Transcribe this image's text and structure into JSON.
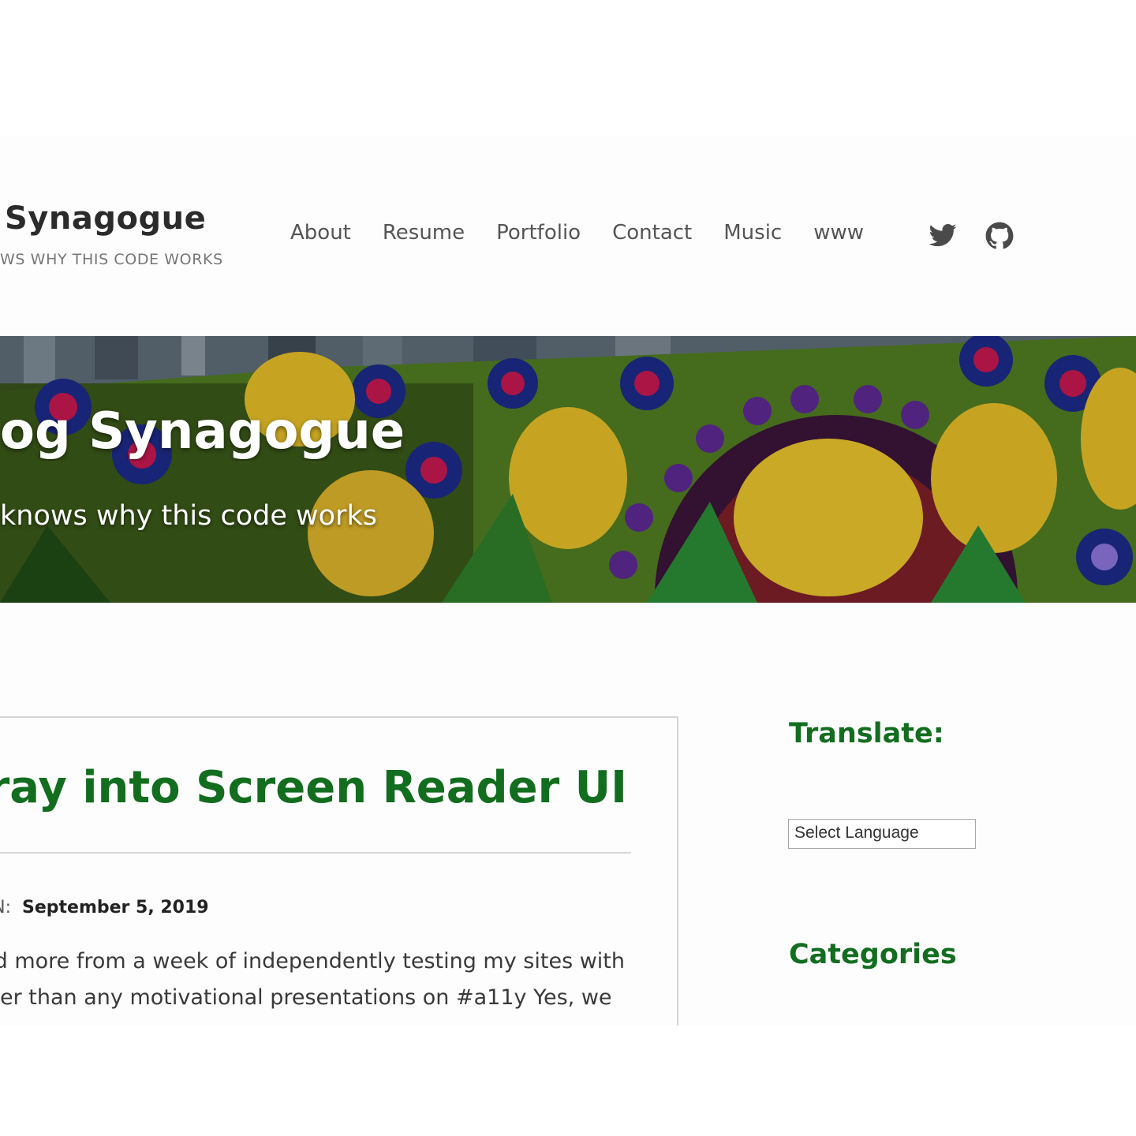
{
  "site": {
    "title": "Synagogue",
    "tagline": "WS WHY THIS CODE WORKS"
  },
  "nav": {
    "items": [
      {
        "label": "About"
      },
      {
        "label": "Resume"
      },
      {
        "label": "Portfolio"
      },
      {
        "label": "Contact"
      },
      {
        "label": "Music"
      },
      {
        "label": "www"
      }
    ]
  },
  "social": {
    "icons": [
      "twitter-icon",
      "github-icon"
    ]
  },
  "hero": {
    "title": "og Synagogue",
    "subtitle": "knows why this code works"
  },
  "post": {
    "title": "oray into Screen Reader UI",
    "meta_label": "N:",
    "date": "September 5, 2019",
    "excerpt_lines": [
      "ed more from a week of independently testing my sites with",
      "er than any motivational presentations on #a11y Yes, we"
    ]
  },
  "sidebar": {
    "translate_title": "Translate:",
    "language_select": "Select Language",
    "categories_title": "Categories"
  },
  "colors": {
    "accent_green": "#136d1f",
    "nav_text": "#555555"
  }
}
